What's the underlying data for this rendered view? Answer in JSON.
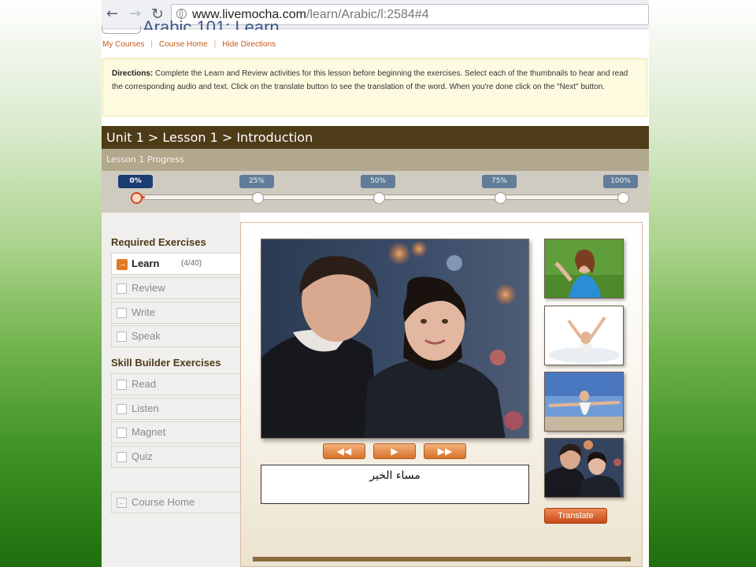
{
  "browser": {
    "url_host": "www.livemocha.com",
    "url_path": "/learn/Arabic/l:2584#4",
    "back_icon": "arrow-left",
    "forward_icon": "arrow-right",
    "reload_icon": "reload"
  },
  "header": {
    "subnav": [
      "My Courses",
      "Course Home",
      "Hide Directions"
    ]
  },
  "directions": {
    "label": "Directions:",
    "text": " Complete the Learn and Review activities for this lesson before beginning the exercises. Select each of the thumbnails to hear and read the corresponding audio and text. Click on the translate button to see the translation of the word. When you're done click on the \"Next\" button."
  },
  "unit_title": "Unit 1 > Lesson 1 > Introduction",
  "progress": {
    "label": "Lesson 1 Progress",
    "value": 0.02,
    "milestones": [
      "0%",
      "25%",
      "50%",
      "75%",
      "100%"
    ]
  },
  "sidebar": {
    "required_heading": "Required Exercises",
    "required": [
      {
        "label": "Learn",
        "count": "(4/40)"
      },
      {
        "label": "Review"
      },
      {
        "label": "Write"
      },
      {
        "label": "Speak"
      }
    ],
    "skill_heading": "Skill Builder Exercises",
    "skill": [
      {
        "label": "Read"
      },
      {
        "label": "Listen"
      },
      {
        "label": "Magnet"
      },
      {
        "label": "Quiz"
      }
    ],
    "course_home": "Course Home"
  },
  "player": {
    "prev": "◀◀",
    "play": "▶",
    "next": "▶▶"
  },
  "phrase": "مساء الخير",
  "translate_label": "Translate",
  "colors": {
    "accent": "#e07a27",
    "unit_bar": "#4e3b17",
    "progress_active": "#1c3d73"
  }
}
